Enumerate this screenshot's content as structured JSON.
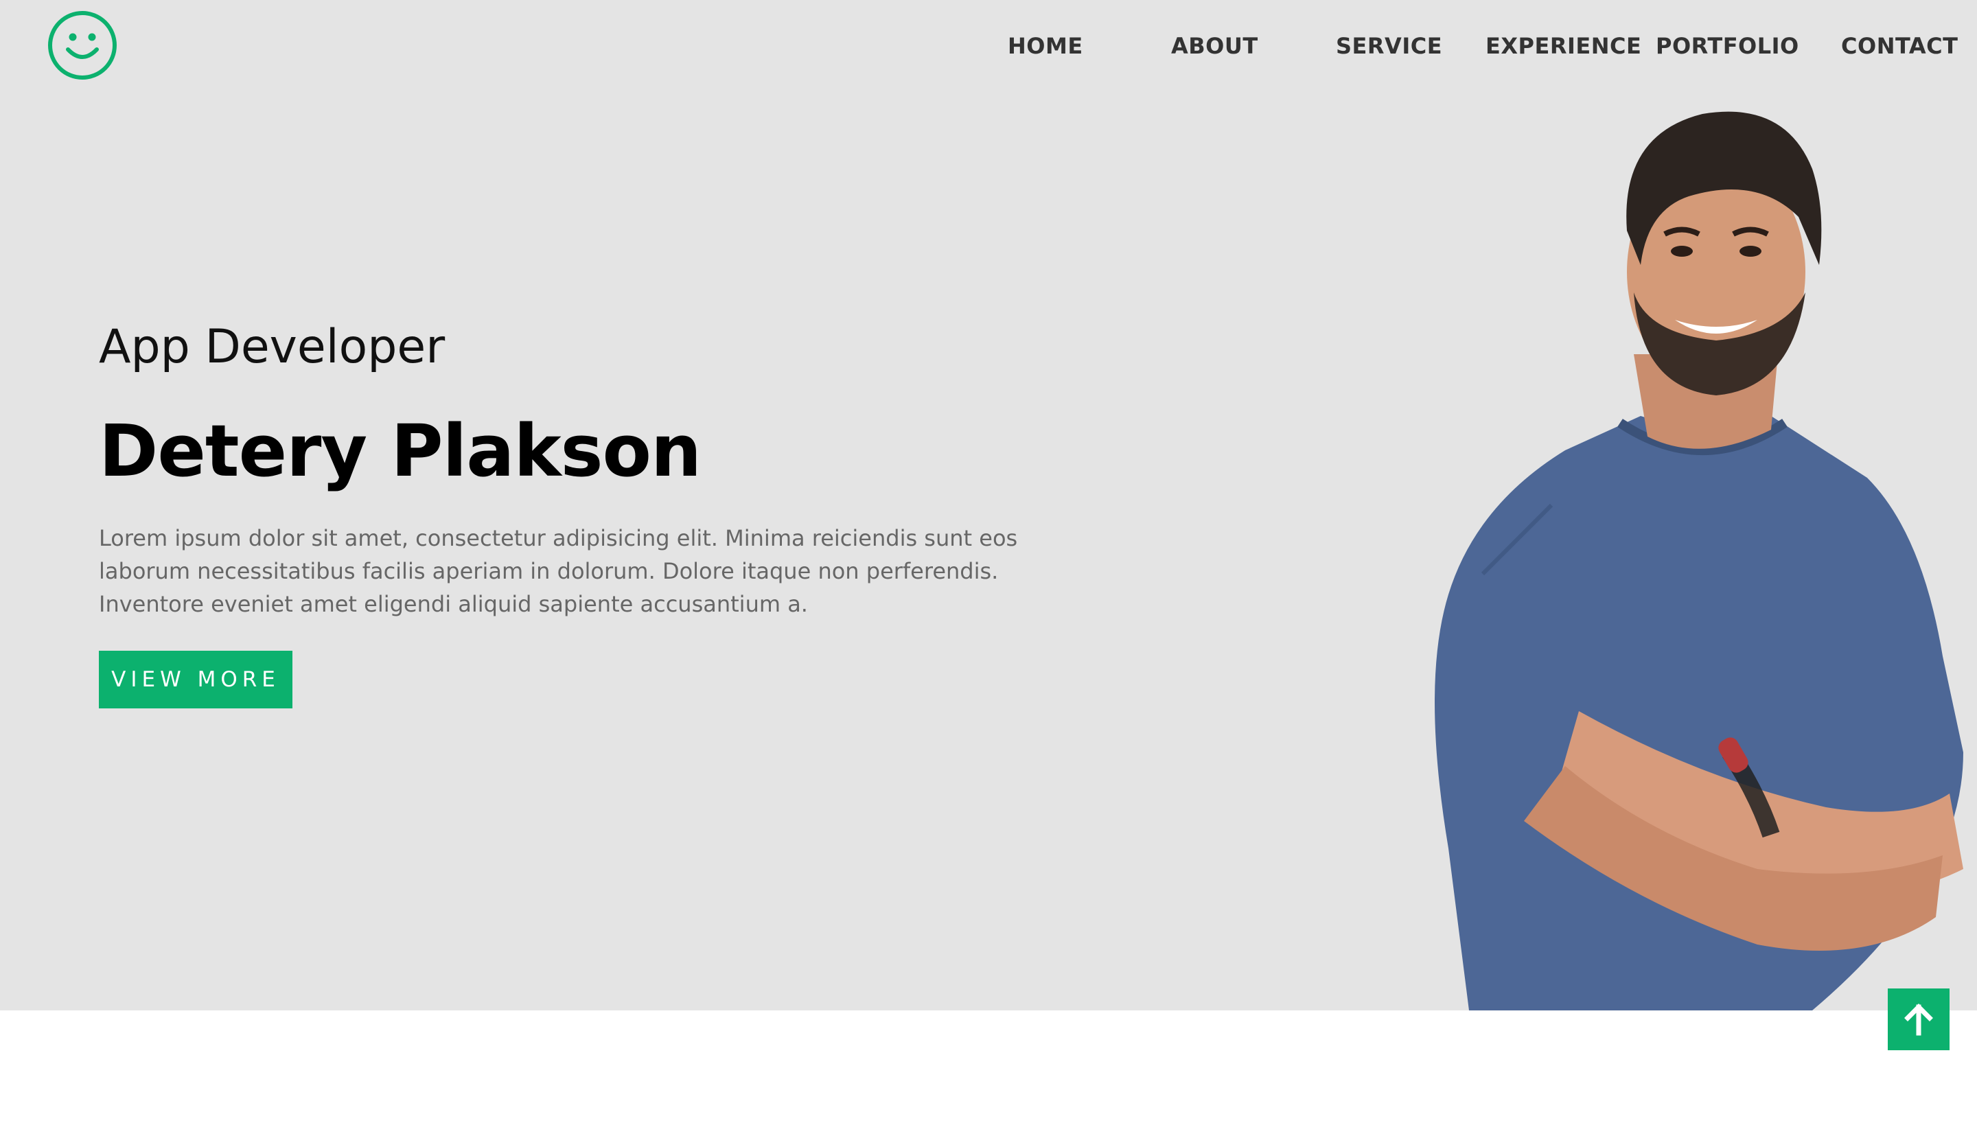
{
  "brand": {
    "logo_icon": "smiley-face-icon",
    "accent_color": "#0cb16e"
  },
  "nav": {
    "items": [
      {
        "label": "HOME"
      },
      {
        "label": "ABOUT"
      },
      {
        "label": "SERVICE"
      },
      {
        "label": "EXPERIENCE"
      },
      {
        "label": "PORTFOLIO"
      },
      {
        "label": "CONTACT"
      }
    ]
  },
  "hero": {
    "subtitle": "App Developer",
    "name": "Detery Plakson",
    "description": "Lorem ipsum dolor sit amet, consectetur adipisicing elit. Minima reiciendis sunt eos laborum necessitatibus facilis aperiam in dolorum. Dolore itaque non perferendis. Inventore eveniet amet eligendi aliquid sapiente accusantium a.",
    "button_label": "VIEW MORE",
    "background_color": "#e4e4e4",
    "portrait": "smiling-man-arms-crossed-portrait"
  },
  "scroll_top": {
    "icon": "arrow-up-icon"
  }
}
